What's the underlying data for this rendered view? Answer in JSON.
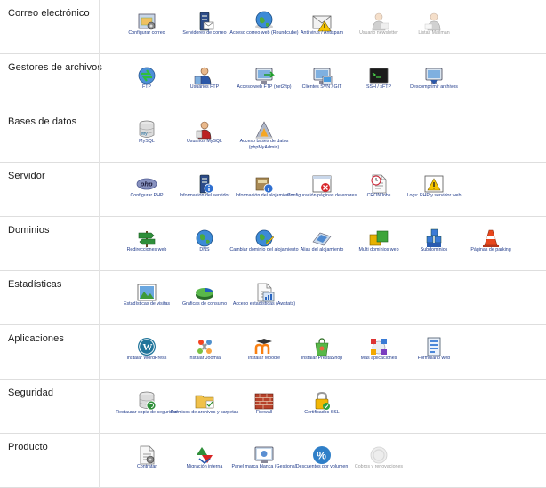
{
  "sections": [
    {
      "title": "Correo electrónico",
      "items": [
        {
          "label": "Configurar correo",
          "icon": "mail-settings-icon"
        },
        {
          "label": "Servidores de correo",
          "icon": "mail-server-icon"
        },
        {
          "label": "Acceso correo web (Roundcube)",
          "icon": "webmail-icon"
        },
        {
          "label": "Anti virus / Antispam",
          "icon": "antispam-icon"
        },
        {
          "label": "Usuario newsletter",
          "icon": "newsletter-user-icon",
          "disabled": true
        },
        {
          "label": "Listas Mailman",
          "icon": "mailman-icon",
          "disabled": true
        }
      ]
    },
    {
      "title": "Gestores de archivos",
      "items": [
        {
          "label": "FTP",
          "icon": "ftp-icon"
        },
        {
          "label": "Usuarios FTP",
          "icon": "ftp-users-icon"
        },
        {
          "label": "Acceso web FTP (net2ftp)",
          "icon": "web-ftp-icon"
        },
        {
          "label": "Clientes SVN / GIT",
          "icon": "svn-git-icon"
        },
        {
          "label": "SSH / sFTP",
          "icon": "terminal-icon"
        },
        {
          "label": "Descomprimir archivos",
          "icon": "decompress-icon"
        }
      ]
    },
    {
      "title": "Bases de datos",
      "items": [
        {
          "label": "MySQL",
          "icon": "mysql-icon"
        },
        {
          "label": "Usuarios MySQL",
          "icon": "mysql-users-icon"
        },
        {
          "label": "Acceso bases de datos (phpMyAdmin)",
          "icon": "phpmyadmin-icon"
        }
      ]
    },
    {
      "title": "Servidor",
      "items": [
        {
          "label": "Configurar PHP",
          "icon": "php-icon"
        },
        {
          "label": "Información del servidor",
          "icon": "server-info-icon"
        },
        {
          "label": "Información del alojamiento",
          "icon": "hosting-info-icon"
        },
        {
          "label": "Configuración páginas de errores",
          "icon": "error-pages-icon"
        },
        {
          "label": "CRONJobs",
          "icon": "cron-icon"
        },
        {
          "label": "Logs: PHP y servidor web",
          "icon": "logs-warning-icon"
        }
      ]
    },
    {
      "title": "Dominios",
      "items": [
        {
          "label": "Redirecciones web",
          "icon": "redirect-sign-icon"
        },
        {
          "label": "DNS",
          "icon": "globe-icon"
        },
        {
          "label": "Cambiar dominio del alojamiento",
          "icon": "change-domain-icon"
        },
        {
          "label": "Alias del alojamiento",
          "icon": "alias-icon"
        },
        {
          "label": "Multi dominios web",
          "icon": "multi-domain-icon"
        },
        {
          "label": "Subdominios",
          "icon": "subdomains-icon"
        },
        {
          "label": "Páginas de parking",
          "icon": "parking-cone-icon"
        }
      ]
    },
    {
      "title": "Estadísticas",
      "items": [
        {
          "label": "Estadísticas de visitas",
          "icon": "stats-image-icon"
        },
        {
          "label": "Gráficas de consumo",
          "icon": "pie-chart-icon"
        },
        {
          "label": "Acceso estadísticas (Awstats)",
          "icon": "awstats-icon"
        }
      ]
    },
    {
      "title": "Aplicaciones",
      "items": [
        {
          "label": "Instalar WordPress",
          "icon": "wordpress-icon"
        },
        {
          "label": "Instalar Joomla",
          "icon": "joomla-icon"
        },
        {
          "label": "Instalar Moodle",
          "icon": "moodle-icon"
        },
        {
          "label": "Instalar PrestaShop",
          "icon": "prestashop-icon"
        },
        {
          "label": "Más aplicaciones",
          "icon": "more-apps-icon"
        },
        {
          "label": "Formulario web",
          "icon": "web-form-icon"
        }
      ]
    },
    {
      "title": "Seguridad",
      "items": [
        {
          "label": "Restaurar copia de seguridad",
          "icon": "backup-restore-icon"
        },
        {
          "label": "Permisos de archivos y carpetas",
          "icon": "folder-permissions-icon"
        },
        {
          "label": "Firewall",
          "icon": "firewall-icon"
        },
        {
          "label": "Certificados SSL",
          "icon": "ssl-lock-icon"
        }
      ]
    },
    {
      "title": "Producto",
      "items": [
        {
          "label": "Contratar",
          "icon": "contract-icon"
        },
        {
          "label": "Migración interna",
          "icon": "migration-icon"
        },
        {
          "label": "Panel marca blanca (Gestiona)",
          "icon": "white-label-icon"
        },
        {
          "label": "Descuentos por volumen",
          "icon": "discount-icon"
        },
        {
          "label": "Cobros y renovaciones",
          "icon": "billing-icon",
          "disabled": true
        }
      ]
    }
  ]
}
